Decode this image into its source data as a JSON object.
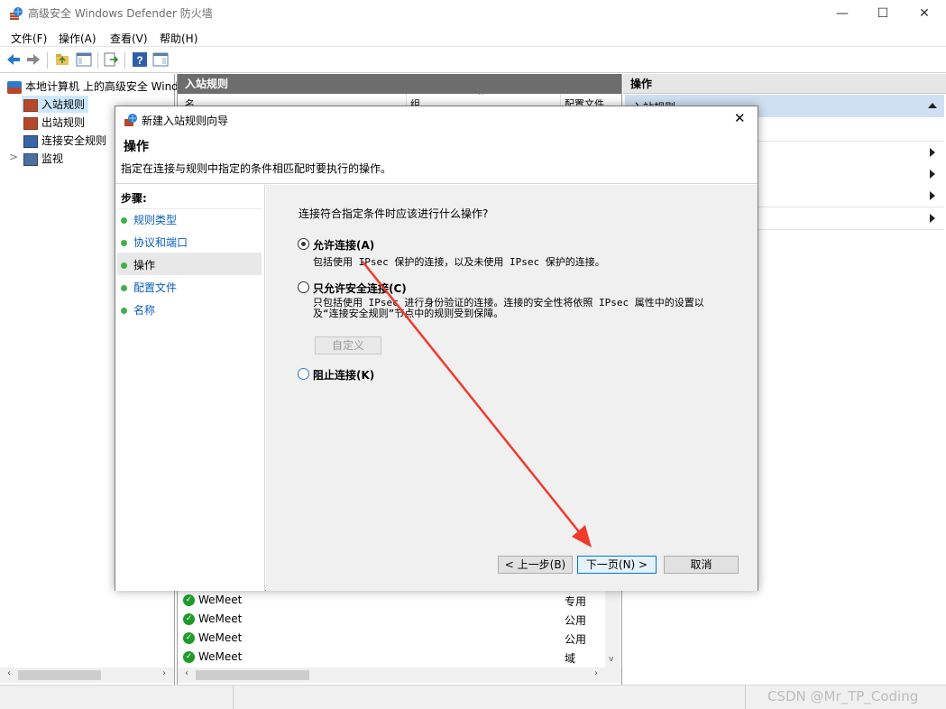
{
  "window": {
    "title": "高级安全 Windows Defender 防火墙",
    "minimize_glyph": "—",
    "maximize_glyph": "☐",
    "close_glyph": "✕"
  },
  "menu": [
    "文件(F)",
    "操作(A)",
    "查看(V)",
    "帮助(H)"
  ],
  "tree": {
    "root": "本地计算机 上的高级安全 Wind",
    "items": [
      "入站规则",
      "出站规则",
      "连接安全规则",
      "监视"
    ],
    "expand_glyph": ">"
  },
  "middle": {
    "header": "入站规则",
    "col_partial_1": "名",
    "col_partial_2": "组",
    "col_partial_3": "配置文件",
    "rows": [
      {
        "name": "WeMeet",
        "profile": "专用"
      },
      {
        "name": "WeMeet",
        "profile": "公用"
      },
      {
        "name": "WeMeet",
        "profile": "公用"
      },
      {
        "name": "WeMeet",
        "profile": "域"
      }
    ]
  },
  "right": {
    "header": "操作",
    "subheader": "入站规则"
  },
  "dialog": {
    "title": "新建入站规则向导",
    "heading": "操作",
    "description": "指定在连接与规则中指定的条件相匹配时要执行的操作。",
    "steps_title": "步骤:",
    "steps": [
      "规则类型",
      "协议和端口",
      "操作",
      "配置文件",
      "名称"
    ],
    "question": "连接符合指定条件时应该进行什么操作?",
    "options": [
      {
        "label": "允许连接(A)",
        "desc": "包括使用 IPsec 保护的连接，以及未使用 IPsec 保护的连接。",
        "selected": true
      },
      {
        "label": "只允许安全连接(C)",
        "desc": "只包括使用 IPsec 进行身份验证的连接。连接的安全性将依照 IPsec 属性中的设置以及“连接安全规则”节点中的规则受到保障。",
        "selected": false
      },
      {
        "label": "阻止连接(K)",
        "desc": "",
        "selected": false
      }
    ],
    "customize_label": "自定义",
    "back_label": "< 上一步(B)",
    "next_label": "下一页(N) >",
    "cancel_label": "取消",
    "close_glyph": "✕"
  },
  "watermark": "CSDN @Mr_TP_Coding",
  "colors": {
    "pane_header": "#6d6d6d",
    "step_link": "#0a5fbf",
    "arrow": "#f03a2c",
    "check_green": "#1e9b2a"
  }
}
